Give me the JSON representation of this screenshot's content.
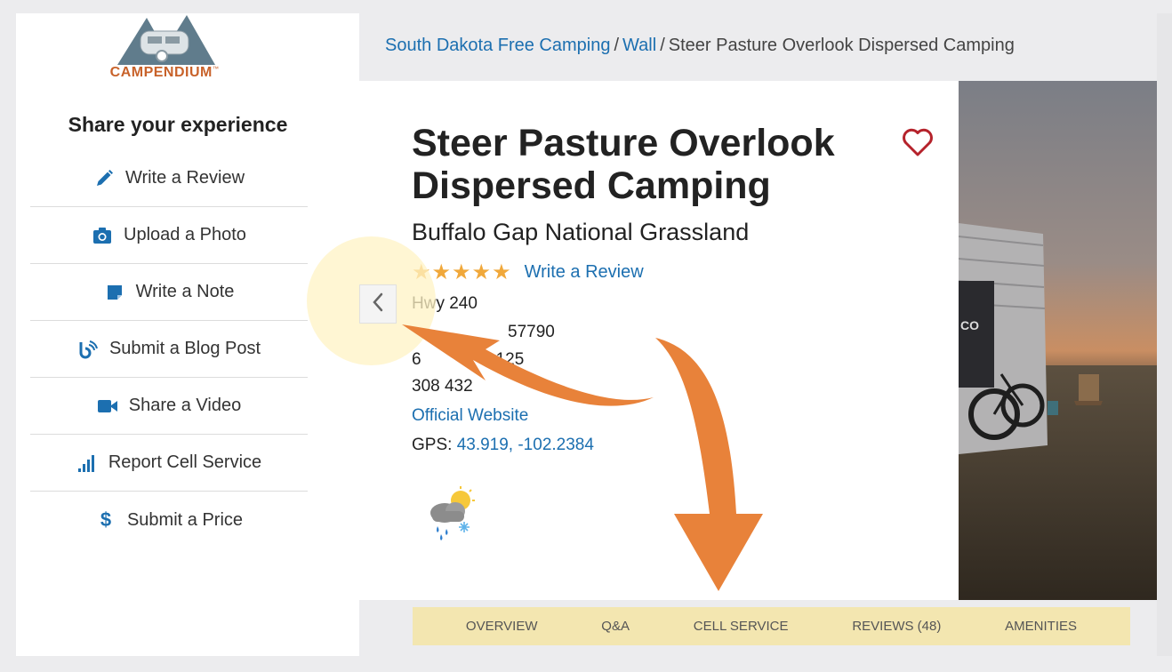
{
  "logo": {
    "text": "CAMPENDIUM",
    "trademark": "™"
  },
  "sidebar": {
    "title": "Share your experience",
    "items": [
      {
        "label": "Write a Review",
        "icon": "pencil-icon"
      },
      {
        "label": "Upload a Photo",
        "icon": "camera-icon"
      },
      {
        "label": "Write a Note",
        "icon": "note-icon"
      },
      {
        "label": "Submit a Blog Post",
        "icon": "blog-icon"
      },
      {
        "label": "Share a Video",
        "icon": "video-icon"
      },
      {
        "label": "Report Cell Service",
        "icon": "signal-icon"
      },
      {
        "label": "Submit a Price",
        "icon": "dollar-icon"
      }
    ]
  },
  "breadcrumb": {
    "items": [
      "South Dakota Free Camping",
      "Wall"
    ],
    "current": "Steer Pasture Overlook Dispersed Camping",
    "separator": "/"
  },
  "campground": {
    "title": "Steer Pasture Overlook Dispersed Camping",
    "subtitle": "Buffalo Gap National Grassland",
    "stars": "★★★★★",
    "rating": 5,
    "write_review": "Write a Review",
    "address": "Hwy 240",
    "zip_partial": "57790",
    "phone1_prefix": "6",
    "phone1_suffix": "125",
    "phone2_prefix": "308",
    "phone2_partial": "432",
    "website": "Official Website",
    "gps_label": "GPS:",
    "gps_value": "43.919, -102.2384"
  },
  "tabs": [
    "OVERVIEW",
    "Q&A",
    "CELL SERVICE",
    "REVIEWS (48)",
    "AMENITIES"
  ],
  "colors": {
    "link": "#1c6fb0",
    "star": "#f0a83b",
    "heart": "#b5222b",
    "logo": "#c8622a",
    "tab_bar": "#f3e6b0",
    "annotation_arrow": "#e8823a"
  }
}
